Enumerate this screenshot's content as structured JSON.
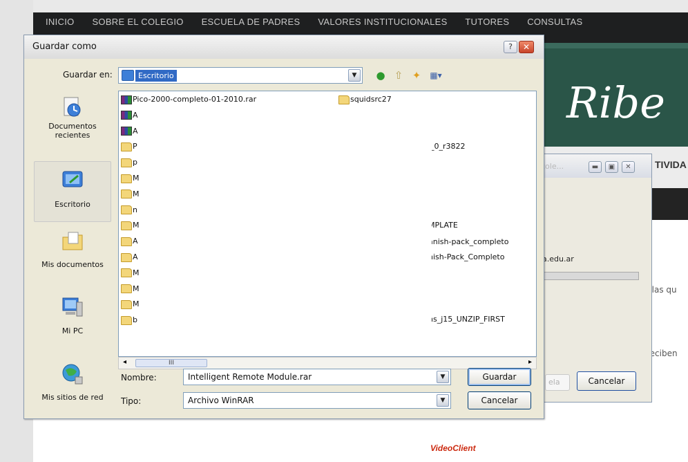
{
  "site": {
    "nav": [
      "INICIO",
      "SOBRE EL COLEGIO",
      "ESCUELA DE PADRES",
      "VALORES INSTITUCIONALES",
      "TUTORES",
      "CONSULTAS"
    ],
    "banner_title": "Ribe",
    "menu_partial": "TIVIDA",
    "text_partial_1": ", las qu",
    "text_partial_2": "reciben",
    "videoclient": "VideoClient"
  },
  "progress_window": {
    "title": "cole...",
    "url": "a.edu.ar",
    "progress_fraction": 0.0,
    "ghost_button": "ela",
    "cancel_label": "Cancelar"
  },
  "dialog": {
    "title": "Guardar como",
    "save_in_label": "Guardar en:",
    "save_in_value": "Escritorio",
    "places": [
      {
        "label": "Documentos\nrecientes",
        "icon": "recent-documents-icon"
      },
      {
        "label": "Escritorio",
        "icon": "desktop-icon"
      },
      {
        "label": "Mis documentos",
        "icon": "my-documents-icon"
      },
      {
        "label": "Mi PC",
        "icon": "my-computer-icon"
      },
      {
        "label": "Mis sitios de red",
        "icon": "network-places-icon"
      }
    ],
    "files_col1": [
      {
        "name": "Pico-2000-completo-01-2010.rar",
        "type": "rar"
      },
      {
        "name": "A",
        "type": "rar"
      },
      {
        "name": "A",
        "type": "rar"
      },
      {
        "name": "P",
        "type": "folder"
      },
      {
        "name": "p",
        "type": "folder"
      },
      {
        "name": "M",
        "type": "folder"
      },
      {
        "name": "M",
        "type": "folder"
      },
      {
        "name": "n",
        "type": "folder"
      },
      {
        "name": "M",
        "type": "folder"
      },
      {
        "name": "A",
        "type": "folder"
      },
      {
        "name": "A",
        "type": "folder"
      },
      {
        "name": "M",
        "type": "folder"
      },
      {
        "name": "M",
        "type": "folder"
      },
      {
        "name": "M",
        "type": "folder"
      },
      {
        "name": "b",
        "type": "folder"
      }
    ],
    "files_col2": [
      {
        "name": "squidsrc27",
        "type": "folder"
      },
      {
        "name": "'_0_r3822",
        "type": "text"
      },
      {
        "name": "MPLATE",
        "type": "text"
      },
      {
        "name": "anish-pack_completo",
        "type": "text"
      },
      {
        "name": "nish-Pack_Completo",
        "type": "text"
      },
      {
        "name": "ns_j15_UNZIP_FIRST",
        "type": "text"
      }
    ],
    "scroll_thumb": "III",
    "name_label": "Nombre:",
    "name_value": "Intelligent Remote Module.rar",
    "type_label": "Tipo:",
    "type_value": "Archivo WinRAR",
    "save_button": "Guardar",
    "cancel_button": "Cancelar"
  }
}
